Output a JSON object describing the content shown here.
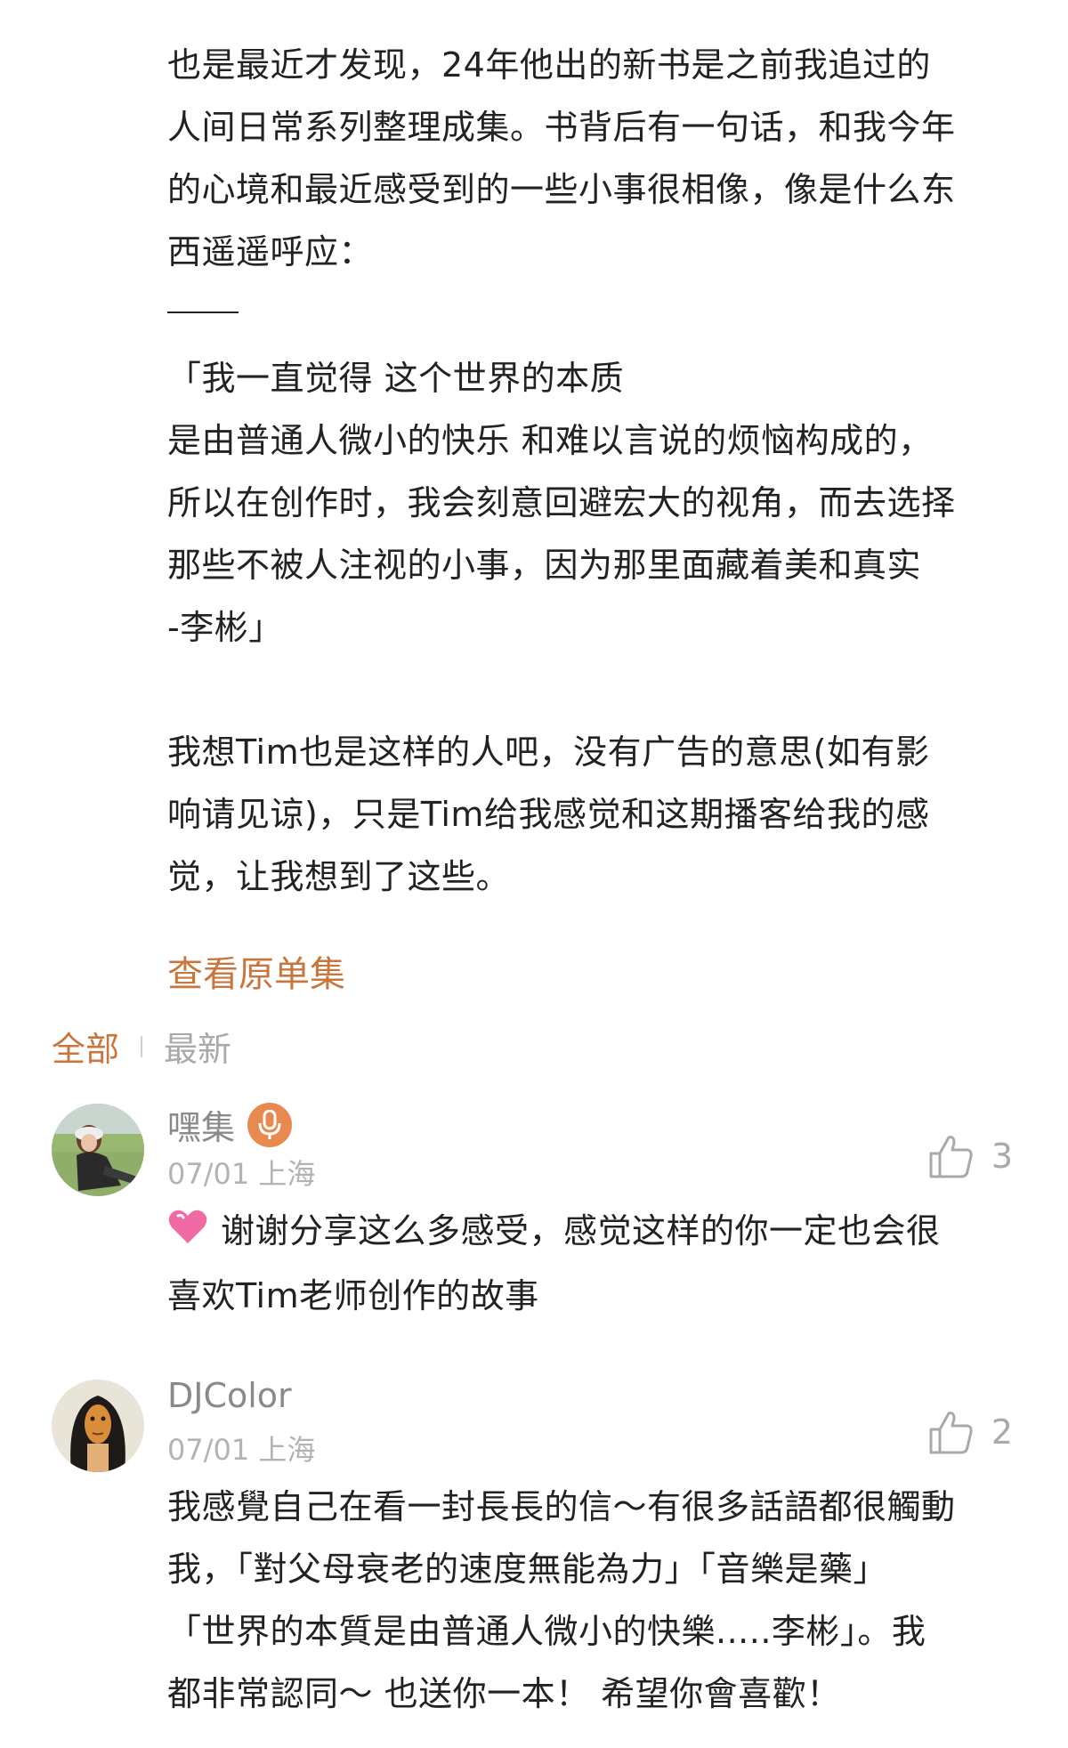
{
  "post": {
    "para1": [
      "也是最近才发现，24年他出的新书是之前我追过的",
      "人间日常系列整理成集。书背后有一句话，和我今年",
      "的心境和最近感受到的一些小事很相像，像是什么东",
      "西遥遥呼应："
    ],
    "quote": [
      "「我一直觉得 这个世界的本质",
      "是由普通人微小的快乐 和难以言说的烦恼构成的，",
      "所以在创作时，我会刻意回避宏大的视角，而去选择",
      "那些不被人注视的小事，因为那里面藏着美和真实",
      "-李彬」"
    ],
    "para2": [
      "我想Tim也是这样的人吧，没有广告的意思(如有影",
      "响请见谅)，只是Tim给我感觉和这期播客给我的感",
      "觉，让我想到了这些。"
    ]
  },
  "view_original_label": "查看原单集",
  "tabs": {
    "all": "全部",
    "latest": "最新"
  },
  "comments": [
    {
      "name": "嘿集",
      "date": "07/01",
      "location": "上海",
      "likes": "3",
      "lines": [
        "谢谢分享这么多感受，感觉这样的你一定也会很",
        "喜欢Tim老师创作的故事"
      ]
    },
    {
      "name": "DJColor",
      "date": "07/01",
      "location": "上海",
      "likes": "2",
      "lines": [
        "我感覺自己在看一封長長的信～有很多話語都很觸動",
        "我，「對父母衰老的速度無能為力」「音樂是藥」",
        "「世界的本質是由普通人微小的快樂.....李彬」。我",
        "都非常認同～ 也送你一本！ 希望你會喜歡！"
      ]
    }
  ],
  "colors": {
    "accent": "#c8763d",
    "mic_badge": "#e8894f",
    "muted": "#a9a9a9"
  },
  "icons": {
    "like": "thumbs-up-icon",
    "mic": "microphone-icon",
    "heart": "heart-emoji-icon"
  }
}
